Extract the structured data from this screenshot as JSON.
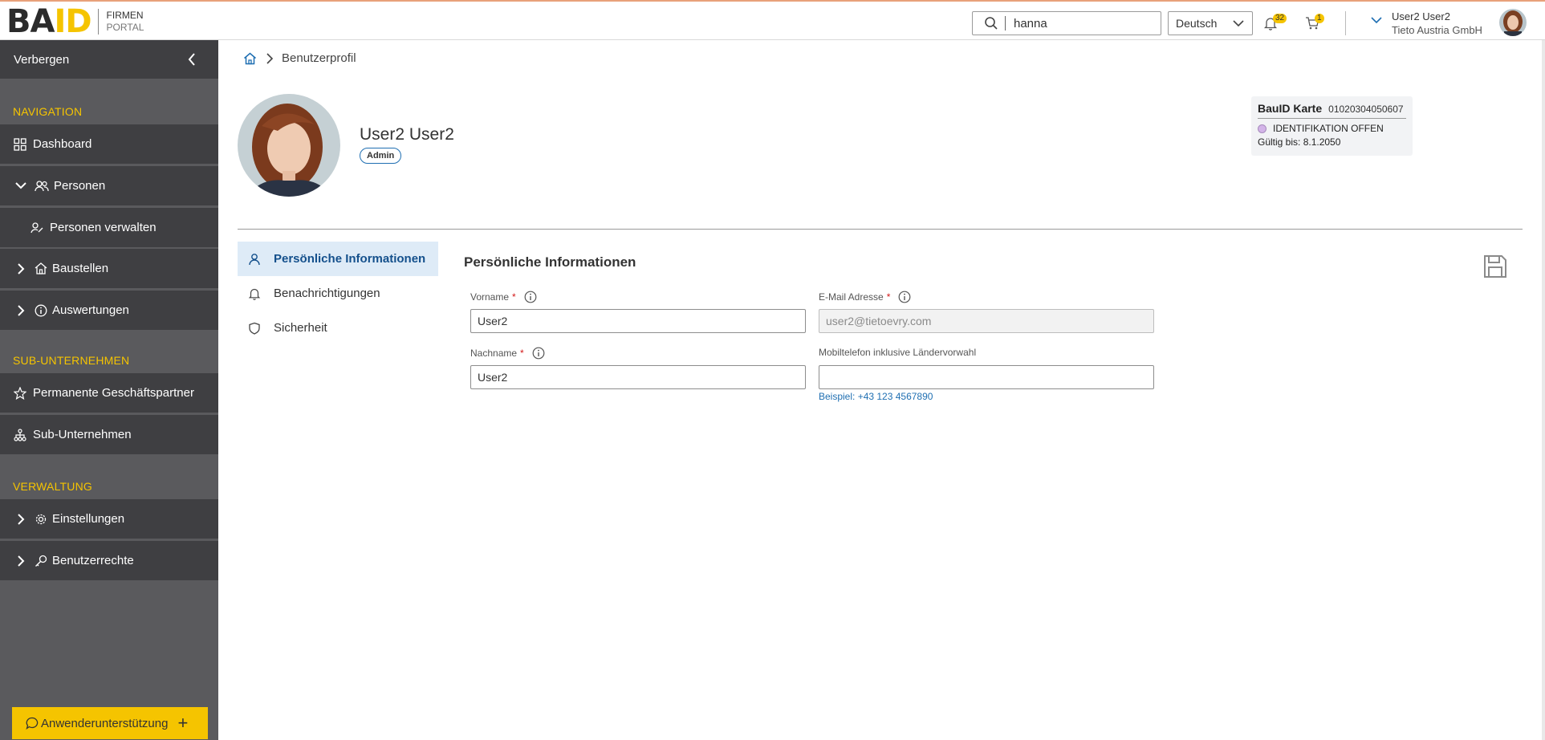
{
  "header": {
    "logo_ba": "BA",
    "logo_id": "ID",
    "logo_line1": "FIRMEN",
    "logo_line2": "PORTAL",
    "search_value": "hanna",
    "language": "Deutsch",
    "notifications_count": "32",
    "cart_count": "1",
    "user_name": "User2 User2",
    "user_company": "Tieto Austria GmbH"
  },
  "sidebar": {
    "toggle_label": "Verbergen",
    "sections": {
      "navigation": "NAVIGATION",
      "sub": "SUB-UNTERNEHMEN",
      "admin": "VERWALTUNG"
    },
    "items": {
      "dashboard": "Dashboard",
      "persons": "Personen",
      "manage_persons": "Personen verwalten",
      "sites": "Baustellen",
      "reports": "Auswertungen",
      "partners": "Permanente Geschäftspartner",
      "subcompanies": "Sub-Unternehmen",
      "settings": "Einstellungen",
      "rights": "Benutzerrechte"
    },
    "support_label": "Anwenderunterstützung"
  },
  "breadcrumb": {
    "current": "Benutzerprofil"
  },
  "profile": {
    "name": "User2 User2",
    "role": "Admin"
  },
  "card": {
    "title": "BauID Karte",
    "number": "01020304050607",
    "status": "IDENTIFIKATION OFFEN",
    "valid_until": "Gültig bis: 8.1.2050",
    "status_color": "#d3b4e8"
  },
  "tabs": {
    "personal": "Persönliche Informationen",
    "notifications": "Benachrichtigungen",
    "security": "Sicherheit"
  },
  "form": {
    "title": "Persönliche Informationen",
    "firstname_label": "Vorname",
    "firstname_value": "User2",
    "email_label": "E-Mail Adresse",
    "email_value": "user2@tietoevry.com",
    "lastname_label": "Nachname",
    "lastname_value": "User2",
    "mobile_label": "Mobiltelefon inklusive Ländervorwahl",
    "mobile_value": "",
    "mobile_hint": "Beispiel: +43 123 4567890",
    "required_mark": "*"
  },
  "colors": {
    "accent": "#f5c400",
    "sidebar_bg": "#5a5a5d",
    "sidebar_item_bg": "#3f3f42",
    "link": "#1f6fb2",
    "active_tab_bg": "#deebf7"
  }
}
